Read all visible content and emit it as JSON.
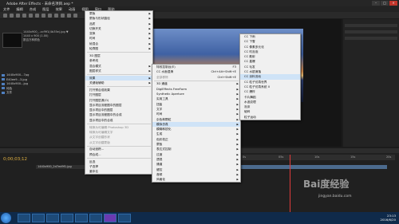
{
  "window": {
    "title": "Adobe After Effects - 未命名项目.aep *"
  },
  "menubar": [
    "文件",
    "编辑",
    "合成",
    "图层",
    "效果",
    "动画",
    "视图",
    "窗口",
    "帮助"
  ],
  "project": {
    "info": [
      "1440x900_..ccf9f1(4b35e).jpg ▼",
      "1440 x 900 (1.00)",
      "数百万种颜色"
    ],
    "files": [
      {
        "name": "1440x900...7pg",
        "type": "ImpJ"
      },
      {
        "name": "E40ee9...3.jpg",
        "type": "ImpJ"
      },
      {
        "name": "1440x900...jpg",
        "type": "ImpJ"
      },
      {
        "name": "纯色",
        "type": "文件夹"
      },
      {
        "name": "文件",
        "type": "文件夹"
      }
    ]
  },
  "timeline": {
    "timecode": "0;00;03;12",
    "layer": "1440x900_2d7ed9f1.jpg",
    "ruler": [
      "0s",
      "05s",
      "10s",
      "15s",
      "20s"
    ]
  },
  "context_menu_1": [
    {
      "label": "蒙版",
      "arrow": true
    },
    {
      "label": "蒙版与形状路径",
      "arrow": true
    },
    {
      "label": "品质",
      "arrow": true
    },
    {
      "label": "切换开关",
      "arrow": true
    },
    {
      "label": "变换",
      "arrow": true
    },
    {
      "label": "时间",
      "arrow": true
    },
    {
      "label": "帧混合",
      "arrow": true
    },
    {
      "label": "轮廓图",
      "arrow": true
    },
    {
      "sep": true
    },
    {
      "label": "3D 图层"
    },
    {
      "label": "参考线"
    },
    {
      "label": "混合模式",
      "arrow": true
    },
    {
      "label": "图层样式",
      "arrow": true
    },
    {
      "sep": true
    },
    {
      "label": "效果",
      "arrow": true,
      "highlight": true
    },
    {
      "label": "关键帧辅助",
      "arrow": true
    },
    {
      "sep": true
    },
    {
      "label": "打开预合成效果"
    },
    {
      "label": "打开图层"
    },
    {
      "label": "打开图层源(O)"
    },
    {
      "label": "显示项目流程图中的图层"
    },
    {
      "label": "显示项目中的图层"
    },
    {
      "label": "显示项目流程图中的合成"
    },
    {
      "label": "显示项目中的合成"
    },
    {
      "sep": true
    },
    {
      "label": "转换为可编辑 Photoshop 3D",
      "disabled": true
    },
    {
      "label": "转换为可编辑文字",
      "disabled": true
    },
    {
      "label": "从文字创建形状",
      "disabled": true
    },
    {
      "label": "从文字创建蒙版",
      "disabled": true
    },
    {
      "sep": true
    },
    {
      "label": "自动追踪..."
    },
    {
      "label": "预合成..."
    },
    {
      "sep": true
    },
    {
      "label": "反选"
    },
    {
      "label": "子选择"
    },
    {
      "label": "重命名"
    }
  ],
  "context_menu_2": [
    {
      "label": "特效控制台(E)",
      "shortcut": "F3"
    },
    {
      "label": "CC 水面湿滑",
      "shortcut": "Ctrl+Alt+Shift+E"
    },
    {
      "label": "全部移除",
      "shortcut": "Ctrl+Shift+E",
      "disabled": true
    },
    {
      "sep": true
    },
    {
      "label": "3D 通道",
      "arrow": true
    },
    {
      "label": "DigiEffects FreeForm",
      "arrow": true
    },
    {
      "label": "Synthetic Aperture",
      "arrow": true
    },
    {
      "label": "实用工具",
      "arrow": true
    },
    {
      "label": "扭曲",
      "arrow": true
    },
    {
      "label": "文字",
      "arrow": true
    },
    {
      "label": "时间",
      "arrow": true
    },
    {
      "label": "杂色和颗粒",
      "arrow": true
    },
    {
      "label": "模拟仿真",
      "arrow": true,
      "highlight": true
    },
    {
      "label": "模糊和锐化",
      "arrow": true
    },
    {
      "label": "生成",
      "arrow": true
    },
    {
      "label": "色彩校正",
      "arrow": true
    },
    {
      "label": "蒙板",
      "arrow": true
    },
    {
      "label": "表达式控制",
      "arrow": true
    },
    {
      "label": "过渡",
      "arrow": true
    },
    {
      "label": "透视",
      "arrow": true
    },
    {
      "label": "通道",
      "arrow": true
    },
    {
      "label": "键控",
      "arrow": true
    },
    {
      "label": "音频",
      "arrow": true
    },
    {
      "label": "风格化",
      "arrow": true
    }
  ],
  "context_menu_3": [
    {
      "label": "CC 下雨"
    },
    {
      "label": "CC 下雪"
    },
    {
      "label": "CC 像素多元化"
    },
    {
      "label": "CC 吹泡泡"
    },
    {
      "label": "CC 散射"
    },
    {
      "label": "CC 星爆"
    },
    {
      "label": "CC 毛发"
    },
    {
      "label": "CC 水银滴落"
    },
    {
      "label": "CC 涂料流动",
      "highlight": true
    },
    {
      "label": "CC 粒子仿真世界"
    },
    {
      "label": "CC 粒子仿真系统 II"
    },
    {
      "label": "CC 爆炸"
    },
    {
      "label": "卡片舞蹈"
    },
    {
      "label": "水波纹理"
    },
    {
      "label": "泡沫"
    },
    {
      "label": "破碎"
    },
    {
      "label": "粒子运动"
    }
  ],
  "taskbar": {
    "time": "23:13",
    "date": "2016/6/20"
  },
  "watermark": {
    "logo": "Bai度经验",
    "url": "jingyan.baidu.com"
  }
}
